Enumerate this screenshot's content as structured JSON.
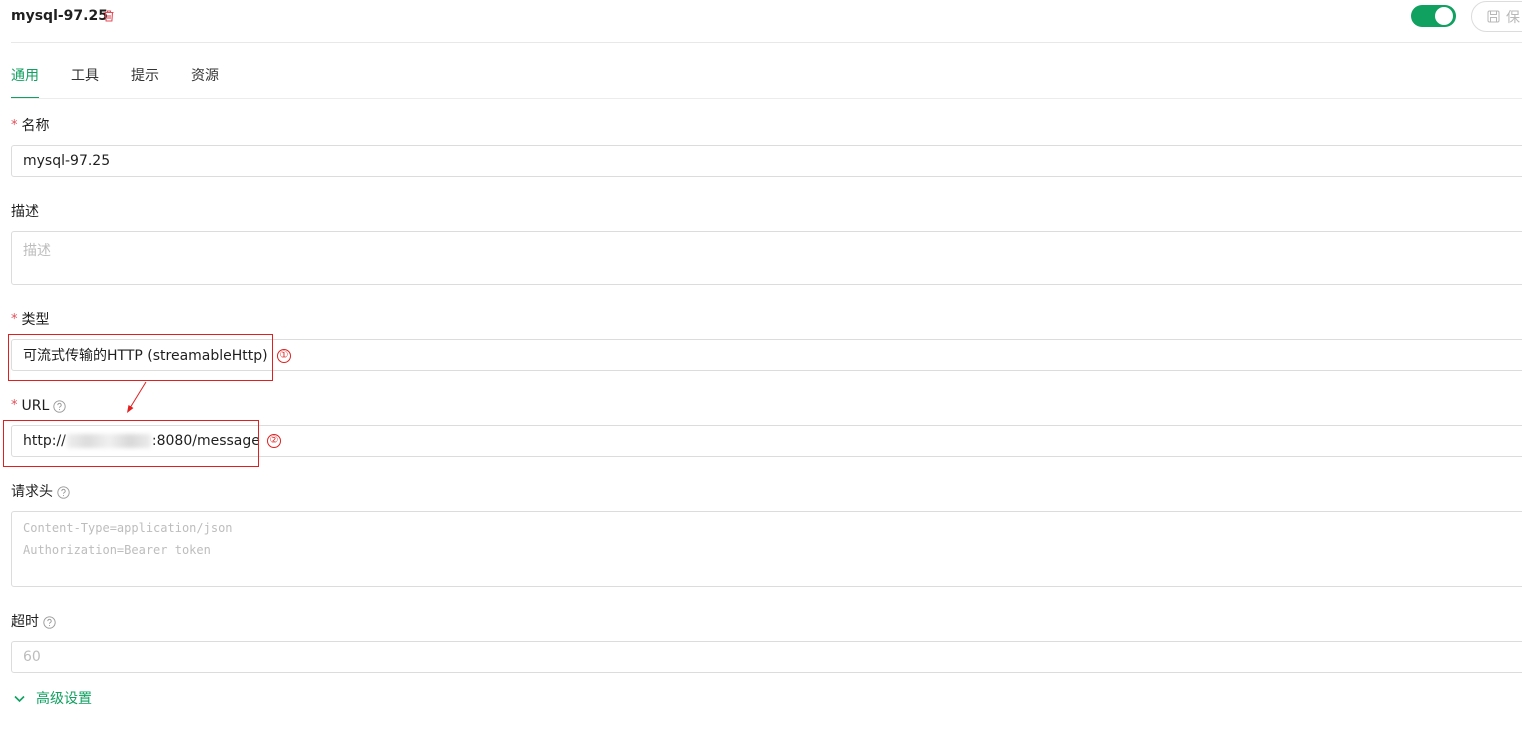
{
  "header": {
    "title": "mysql-97.25",
    "save_label": "保",
    "toggle_on": true
  },
  "tabs": [
    {
      "label": "通用",
      "active": true
    },
    {
      "label": "工具",
      "active": false
    },
    {
      "label": "提示",
      "active": false
    },
    {
      "label": "资源",
      "active": false
    }
  ],
  "form": {
    "name": {
      "required_mark": "*",
      "label": "名称",
      "value": "mysql-97.25"
    },
    "description": {
      "label": "描述",
      "placeholder": "描述"
    },
    "type": {
      "required_mark": "*",
      "label": "类型",
      "value": "可流式传输的HTTP (streamableHttp)"
    },
    "url": {
      "required_mark": "*",
      "label": "URL",
      "value_prefix": "http://",
      "value_suffix": ":8080/message"
    },
    "headers": {
      "label": "请求头",
      "placeholder_lines": [
        "Content-Type=application/json",
        "Authorization=Bearer token"
      ]
    },
    "timeout": {
      "label": "超时",
      "placeholder": "60"
    },
    "advanced": {
      "label": "高级设置"
    }
  },
  "annotations": [
    {
      "number": "①"
    },
    {
      "number": "②"
    }
  ],
  "colors": {
    "accent": "#10a060",
    "required": "#e34d59",
    "annotation": "#e02020"
  }
}
